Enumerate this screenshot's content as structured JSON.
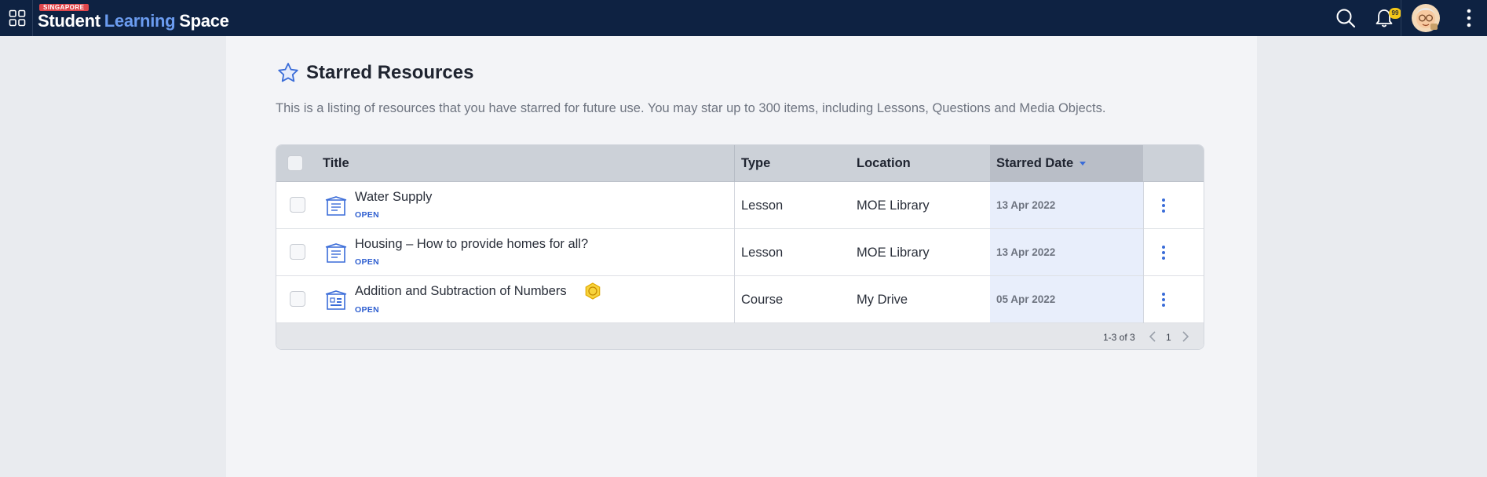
{
  "header": {
    "logo_tag": "SINGAPORE",
    "logo_part1": "Student",
    "logo_part2": "Learning",
    "logo_part3": "Space",
    "notification_count": "99"
  },
  "page": {
    "title": "Starred Resources",
    "description": "This is a listing of resources that you have starred for future use. You may star up to 300 items, including Lessons, Questions and Media Objects."
  },
  "table": {
    "columns": {
      "title": "Title",
      "type": "Type",
      "location": "Location",
      "starred_date": "Starred Date"
    },
    "rows": [
      {
        "title": "Water Supply",
        "action": "OPEN",
        "type": "Lesson",
        "location": "MOE Library",
        "date": "13 Apr 2022",
        "icon": "lesson-icon"
      },
      {
        "title": "Housing – How to provide homes for all?",
        "action": "OPEN",
        "type": "Lesson",
        "location": "MOE Library",
        "date": "13 Apr 2022",
        "icon": "lesson-icon"
      },
      {
        "title": "Addition and Subtraction of Numbers",
        "action": "OPEN",
        "type": "Course",
        "location": "My Drive",
        "date": "05 Apr 2022",
        "icon": "course-icon",
        "badge": "gold-badge-icon"
      }
    ],
    "pagination": {
      "range": "1-3 of 3",
      "page": "1"
    }
  },
  "colors": {
    "topbar": "#0e2242",
    "accent": "#3a6cd8",
    "logo_highlight": "#6b9cf0",
    "badge": "#f2c618"
  }
}
